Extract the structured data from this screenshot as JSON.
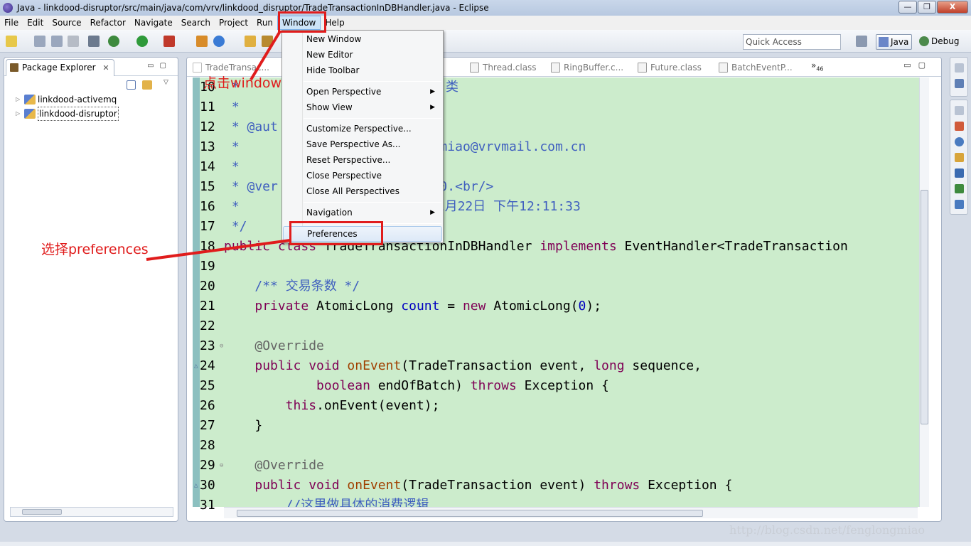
{
  "window": {
    "title": "Java - linkdood-disruptor/src/main/java/com/vrv/linkdood_disruptor/TradeTransactionInDBHandler.java - Eclipse",
    "minimize": "—",
    "maximize": "❐",
    "close": "X"
  },
  "menubar": {
    "items": [
      "File",
      "Edit",
      "Source",
      "Refactor",
      "Navigate",
      "Search",
      "Project",
      "Run",
      "Window",
      "Help"
    ],
    "active": "Window"
  },
  "toolbar": {
    "quick_access_placeholder": "Quick Access",
    "perspectives": [
      "Java",
      "Debug"
    ]
  },
  "package_explorer": {
    "tab_label": "Package Explorer",
    "tab_close": "✕",
    "projects": [
      "linkdood-activemq",
      "linkdood-disruptor"
    ]
  },
  "editor": {
    "tabs": [
      "TradeTransac...",
      "Thread.class",
      "RingBuffer.c...",
      "Future.class",
      "BatchEventP..."
    ],
    "overflow_label": "»",
    "overflow_count": "46",
    "lines": [
      {
        "n": "10",
        "html": "<span class=\"cm\"> * </span>"
      },
      {
        "n": "11",
        "html": "<span class=\"cm\"> *</span>"
      },
      {
        "n": "12",
        "html": "<span class=\"cm\"> * @aut</span>"
      },
      {
        "n": "13",
        "html": "<span class=\"cm\"> *                         gmiao@vrvmail.com.cn</span>"
      },
      {
        "n": "14",
        "html": "<span class=\"cm\"> *</span>"
      },
      {
        "n": "15",
        "html": "<span class=\"cm\"> * @ver                     0.&lt;br/&gt;</span>"
      },
      {
        "n": "16",
        "html": "<span class=\"cm\"> *                        年1月22日 下午12:11:33</span>"
      },
      {
        "n": "17",
        "html": "<span class=\"cm\"> */</span>"
      },
      {
        "n": "18",
        "html": "<span class=\"kw\">public class</span> TradeTransactionInDBHandler <span class=\"kw\">implements</span> EventHandler&lt;TradeTransaction"
      },
      {
        "n": "19",
        "html": ""
      },
      {
        "n": "20",
        "html": "    <span class=\"cm\">/** 交易条数 */</span>"
      },
      {
        "n": "21",
        "html": "    <span class=\"kw\">private</span> AtomicLong <span class=\"nm\">count</span> = <span class=\"kw\">new</span> AtomicLong(<span class=\"nm\">0</span>);"
      },
      {
        "n": "22",
        "html": ""
      },
      {
        "n": "23",
        "html": "    <span class=\"an\">@Override</span>"
      },
      {
        "n": "24",
        "html": "    <span class=\"kw\">public void</span> <span class=\"fn\">onEvent</span>(TradeTransaction event, <span class=\"kw\">long</span> sequence,"
      },
      {
        "n": "25",
        "html": "            <span class=\"kw\">boolean</span> endOfBatch) <span class=\"kw\">throws</span> Exception {"
      },
      {
        "n": "26",
        "html": "        <span class=\"kw\">this</span>.onEvent(event);"
      },
      {
        "n": "27",
        "html": "    }"
      },
      {
        "n": "28",
        "html": ""
      },
      {
        "n": "29",
        "html": "    <span class=\"an\">@Override</span>"
      },
      {
        "n": "30",
        "html": "    <span class=\"kw\">public void</span> <span class=\"fn\">onEvent</span>(TradeTransaction event) <span class=\"kw\">throws</span> Exception {"
      },
      {
        "n": "31",
        "html": "        <span class=\"cm\">//这里做具体的消费逻辑</span>"
      }
    ],
    "partial_comment_char": "类"
  },
  "window_menu": {
    "items": [
      {
        "label": "New Window",
        "sub": false
      },
      {
        "label": "New Editor",
        "sub": false
      },
      {
        "label": "Hide Toolbar",
        "sub": false
      },
      {
        "label": "Open Perspective",
        "sub": true
      },
      {
        "label": "Show View",
        "sub": true
      },
      {
        "label": "Customize Perspective...",
        "sub": false
      },
      {
        "label": "Save Perspective As...",
        "sub": false
      },
      {
        "label": "Reset Perspective...",
        "sub": false
      },
      {
        "label": "Close Perspective",
        "sub": false
      },
      {
        "label": "Close All Perspectives",
        "sub": false
      },
      {
        "label": "Navigation",
        "sub": true
      },
      {
        "label": "Preferences",
        "sub": false
      }
    ],
    "submenu_arrow": "▶"
  },
  "annotations": {
    "click_window": "点击window",
    "choose_preferences": "选择preferences"
  },
  "watermark": "http://blog.csdn.net/fenglongmiao",
  "colors": {
    "annotation_red": "#e01c1c",
    "editor_bg": "#cceccc",
    "keyword": "#7f0055",
    "comment": "#3f5fbf"
  }
}
